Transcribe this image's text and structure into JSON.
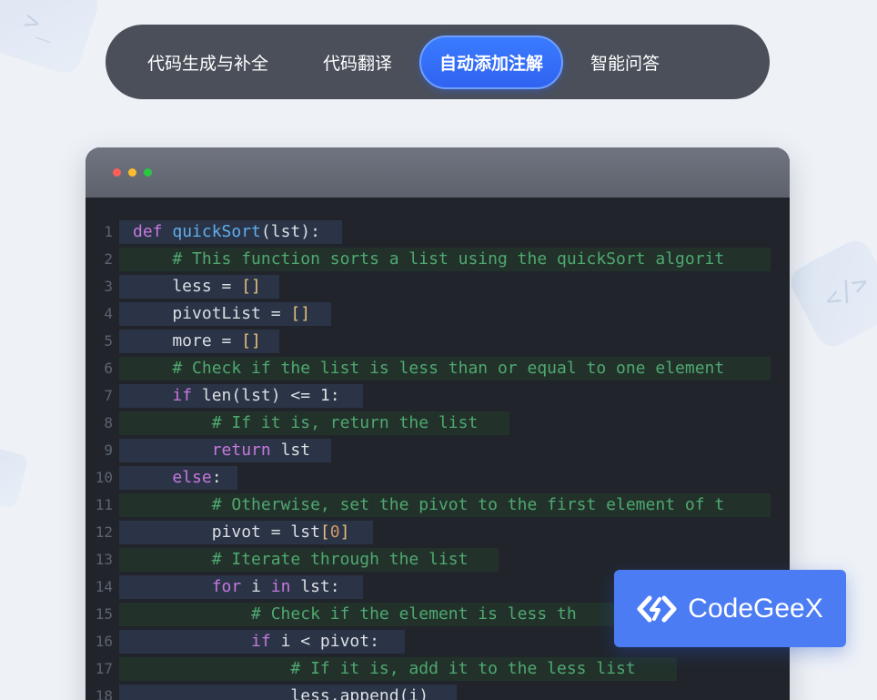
{
  "tabs": [
    {
      "label": "代码生成与补全",
      "active": false
    },
    {
      "label": "代码翻译",
      "active": false
    },
    {
      "label": "自动添加注解",
      "active": true
    },
    {
      "label": "智能问答",
      "active": false
    }
  ],
  "window_controls": [
    "close-icon",
    "minimize-icon",
    "zoom-icon"
  ],
  "code_lines": [
    {
      "n": "1",
      "text": "def quickSort(lst):"
    },
    {
      "n": "2",
      "text": "    # This function sorts a list using the quickSort algorit"
    },
    {
      "n": "3",
      "text": "    less = []"
    },
    {
      "n": "4",
      "text": "    pivotList = []"
    },
    {
      "n": "5",
      "text": "    more = []"
    },
    {
      "n": "6",
      "text": "    # Check if the list is less than or equal to one element"
    },
    {
      "n": "7",
      "text": "    if len(lst) <= 1:"
    },
    {
      "n": "8",
      "text": "        # If it is, return the list"
    },
    {
      "n": "9",
      "text": "        return lst"
    },
    {
      "n": "10",
      "text": "    else:"
    },
    {
      "n": "11",
      "text": "        # Otherwise, set the pivot to the first element of t"
    },
    {
      "n": "12",
      "text": "        pivot = lst[0]"
    },
    {
      "n": "13",
      "text": "        # Iterate through the list"
    },
    {
      "n": "14",
      "text": "        for i in lst:"
    },
    {
      "n": "15",
      "text": "            # Check if the element is less th"
    },
    {
      "n": "16",
      "text": "            if i < pivot:"
    },
    {
      "n": "17",
      "text": "                # If it is, add it to the less list"
    },
    {
      "n": "18",
      "text": "                less.append(i)"
    }
  ],
  "badge": {
    "label": "CodeGeeX",
    "icon": "codegeex-logo-icon"
  },
  "colors": {
    "accent": "#2f63f0",
    "tab_bar": "#4a4f5a",
    "editor_bg": "#21252b",
    "badge": "#4b7cf4"
  }
}
